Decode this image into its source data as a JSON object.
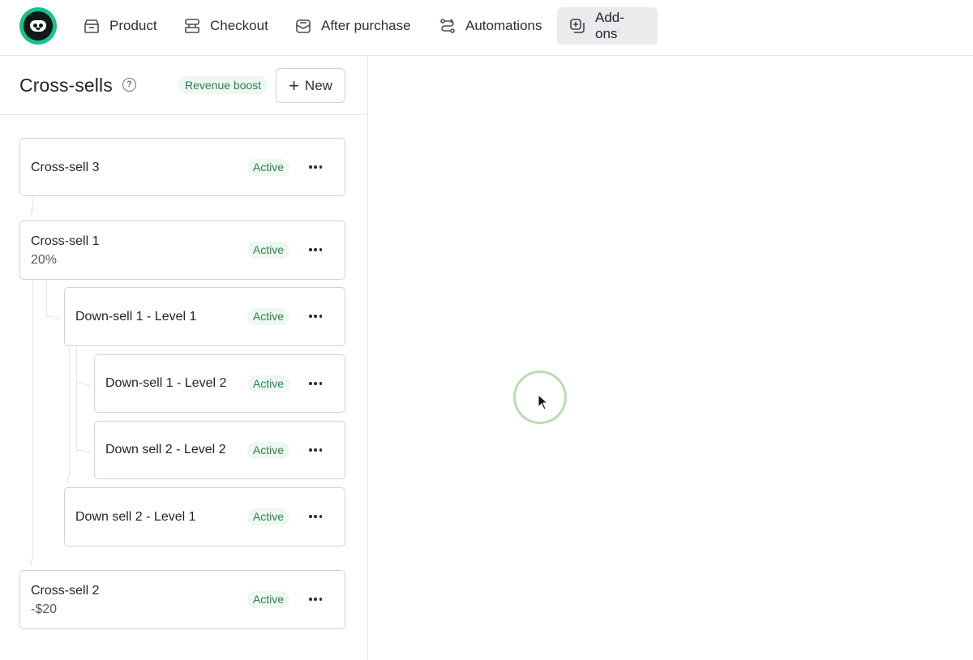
{
  "nav": {
    "tabs": [
      {
        "label": "Product",
        "icon": "box-icon"
      },
      {
        "label": "Checkout",
        "icon": "checkout-icon"
      },
      {
        "label": "After purchase",
        "icon": "inbox-icon"
      },
      {
        "label": "Automations",
        "icon": "route-icon"
      },
      {
        "label": "Add-ons",
        "icon": "add-square-icon",
        "active": true
      }
    ]
  },
  "panel": {
    "title": "Cross-sells",
    "help": "?",
    "badge": "Revenue boost",
    "new_button": {
      "icon": "+",
      "label": "New"
    }
  },
  "items": [
    {
      "name": "Cross-sell 3",
      "sub": "",
      "status": "Active"
    },
    {
      "name": "Cross-sell 1",
      "sub": "20%",
      "status": "Active"
    },
    {
      "name": "Down-sell 1 - Level 1",
      "sub": "",
      "status": "Active"
    },
    {
      "name": "Down-sell 1 - Level 2",
      "sub": "",
      "status": "Active"
    },
    {
      "name": "Down sell 2 - Level 2",
      "sub": "",
      "status": "Active"
    },
    {
      "name": "Down sell 2 - Level 1",
      "sub": "",
      "status": "Active"
    },
    {
      "name": "Cross-sell 2",
      "sub": "-$20",
      "status": "Active"
    }
  ],
  "colors": {
    "active_badge_bg": "#eef7f1",
    "active_badge_text": "#2f7d4f",
    "logo": "#1dbf8f",
    "active_tab_bg": "#e9ebed"
  }
}
